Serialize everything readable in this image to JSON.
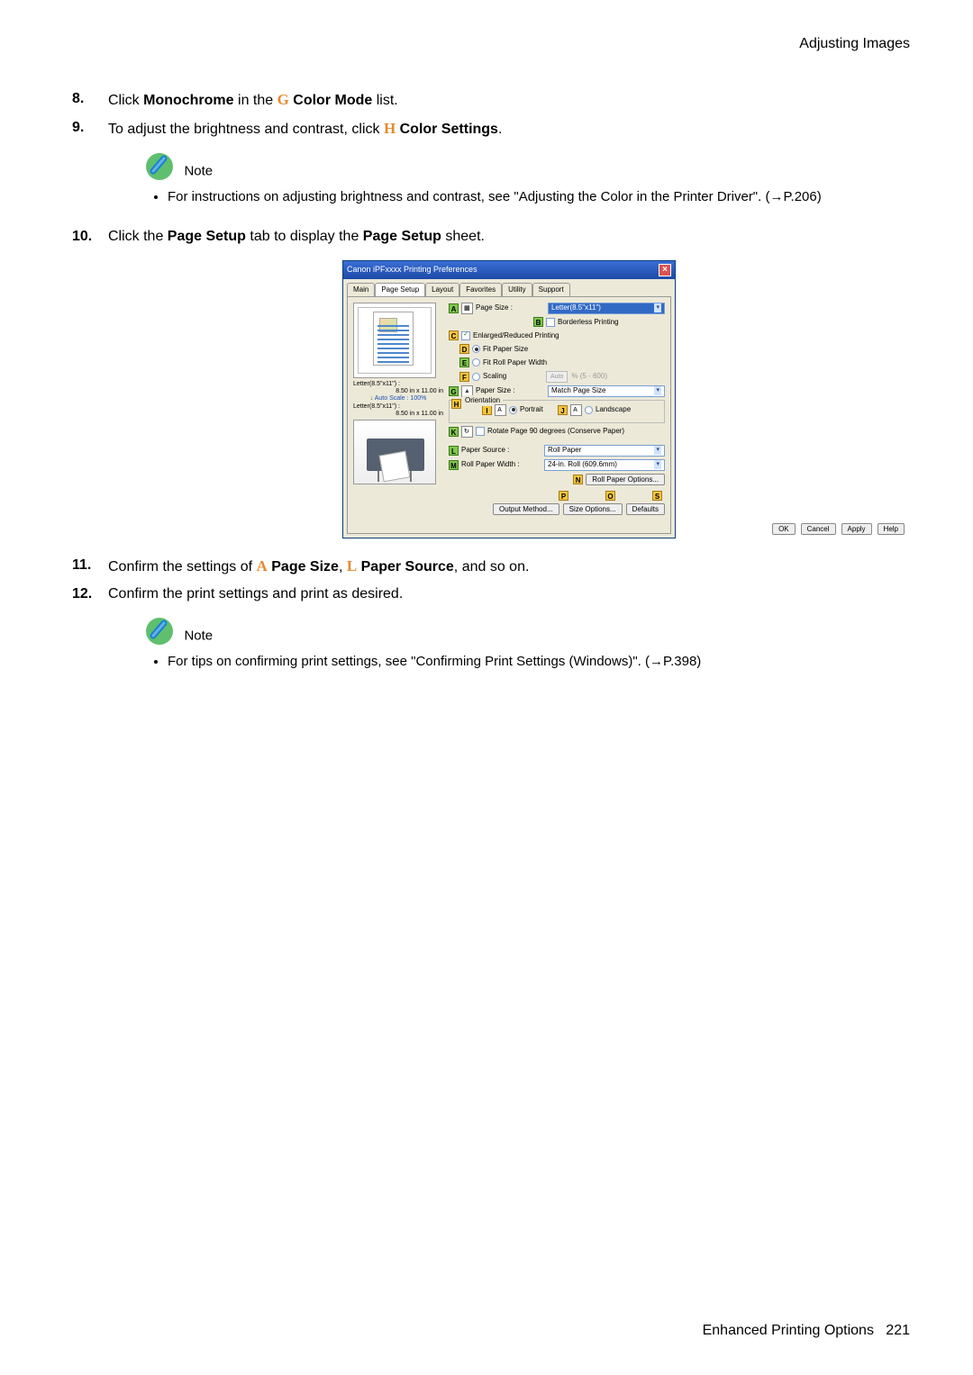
{
  "header": {
    "title": "Adjusting Images"
  },
  "steps": {
    "s8": {
      "num": "8.",
      "pre": "Click ",
      "bold1": "Monochrome",
      "mid": " in the ",
      "letter": "G",
      "bold2": " Color Mode",
      "post": " list."
    },
    "s9": {
      "num": "9.",
      "pre": "To adjust the brightness and contrast, click ",
      "letter": "H",
      "bold": " Color Settings",
      "post": "."
    },
    "s10": {
      "num": "10.",
      "pre": "Click the ",
      "bold1": "Page Setup",
      "mid": " tab to display the ",
      "bold2": "Page Setup",
      "post": " sheet."
    },
    "s11": {
      "num": "11.",
      "pre": "Confirm the settings of ",
      "letterA": "A",
      "bold1": " Page Size",
      "mid1": ", ",
      "letterL": "L",
      "bold2": " Paper Source",
      "post": ", and so on."
    },
    "s12": {
      "num": "12.",
      "text": "Confirm the print settings and print as desired."
    }
  },
  "note1": {
    "label": "Note",
    "text_pre": "For instructions on adjusting brightness and contrast, see \"Adjusting the Color in the Printer Driver\". (",
    "arrow": "→",
    "ref": "P.206",
    "post": ")"
  },
  "note2": {
    "label": "Note",
    "text_pre": "For tips on confirming print settings, see \"Confirming Print Settings (Windows)\".  (",
    "arrow": "→",
    "ref": "P.398",
    "post": ")"
  },
  "dialog": {
    "title": "Canon iPFxxxx Printing Preferences",
    "tabs": [
      "Main",
      "Page Setup",
      "Layout",
      "Favorites",
      "Utility",
      "Support"
    ],
    "pageSize": {
      "label": "Page Size :",
      "value": "Letter(8.5\"x11\")"
    },
    "borderless": {
      "label": "Borderless Printing"
    },
    "enlarged": {
      "label": "Enlarged/Reduced Printing",
      "checked": true
    },
    "fitPaper": {
      "label": "Fit Paper Size",
      "checked": true
    },
    "fitRoll": {
      "label": "Fit Roll Paper Width"
    },
    "scaling": {
      "label": "Scaling",
      "suffix": "%  (5 - 600)",
      "spin": "Auto"
    },
    "paperSize": {
      "label": "Paper Size :",
      "value": "Match Page Size"
    },
    "orientation": {
      "label": "Orientation",
      "portrait": "Portrait",
      "landscape": "Landscape"
    },
    "rotate": {
      "label": "Rotate Page 90 degrees (Conserve Paper)"
    },
    "paperSource": {
      "label": "Paper Source :",
      "value": "Roll Paper"
    },
    "rollWidth": {
      "label": "Roll Paper Width :",
      "value": "24-in. Roll (609.6mm)"
    },
    "rollOptions": "Roll Paper Options...",
    "outputMethod": "Output Method...",
    "sizeOptions": "Size Options...",
    "defaults": "Defaults",
    "ok": "OK",
    "cancel": "Cancel",
    "apply": "Apply",
    "help": "Help",
    "preview": {
      "line1": "Letter(8.5\"x11\") :",
      "line2": "8.50 in x 11.00 in",
      "autoscale_label": "Auto Scale :",
      "autoscale_val": "100%",
      "line3": "Letter(8.5\"x11\") :",
      "line4": "8.50 in x 11.00 in"
    },
    "tags": {
      "A": "A",
      "B": "B",
      "C": "C",
      "D": "D",
      "E": "E",
      "F": "F",
      "G": "G",
      "H": "H",
      "I": "I",
      "J": "J",
      "K": "K",
      "L": "L",
      "M": "M",
      "N": "N",
      "O": "O",
      "P": "P",
      "S": "S"
    }
  },
  "footer": {
    "text": "Enhanced Printing Options",
    "page": "221"
  }
}
